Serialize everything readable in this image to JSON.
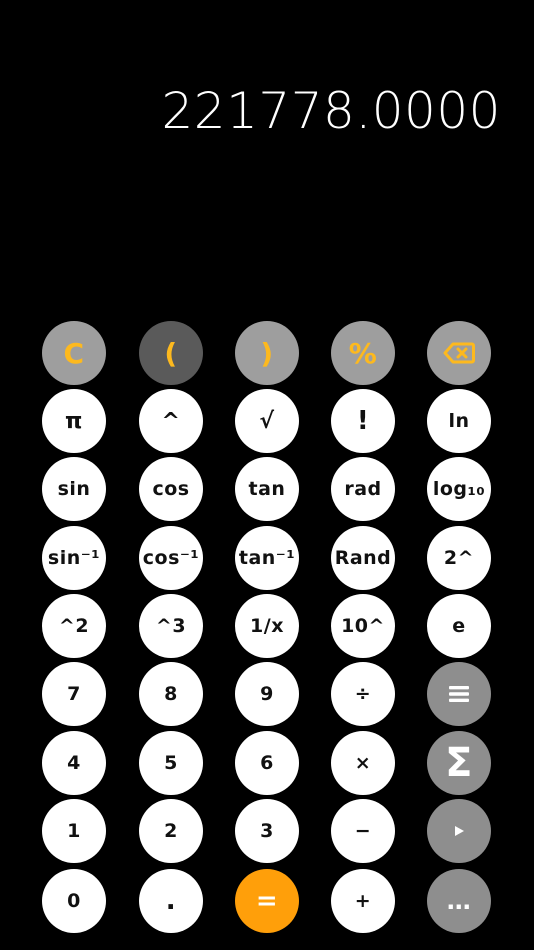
{
  "display": {
    "value": "221778.0000"
  },
  "colors": {
    "background": "#000000",
    "display_text": "#ffffff",
    "key_white": "#ffffff",
    "key_gray": "#8e8e8e",
    "key_top_gray": "#9e9e9e",
    "key_top_dark": "#5a5a5a",
    "accent_yellow": "#fdb91e",
    "equals_orange": "#ff9f0a"
  },
  "keys": {
    "clear": "C",
    "open_paren": "(",
    "close_paren": ")",
    "percent": "%",
    "backspace_icon": "backspace-icon",
    "pi": "π",
    "power": "^",
    "sqrt": "√",
    "factorial": "!",
    "ln": "ln",
    "sin": "sin",
    "cos": "cos",
    "tan": "tan",
    "rad": "rad",
    "log10": "log₁₀",
    "asin": "sin⁻¹",
    "acos": "cos⁻¹",
    "atan": "tan⁻¹",
    "rand": "Rand",
    "two_pow": "2^",
    "square": "^2",
    "cube": "^3",
    "reciprocal": "1/x",
    "ten_pow": "10^",
    "e": "e",
    "d7": "7",
    "d8": "8",
    "d9": "9",
    "divide": "÷",
    "menu_icon": "menu-icon",
    "d4": "4",
    "d5": "5",
    "d6": "6",
    "multiply": "×",
    "sigma": "Σ",
    "d1": "1",
    "d2": "2",
    "d3": "3",
    "minus": "−",
    "play_icon": "play-icon",
    "d0": "0",
    "dot": ".",
    "equals": "=",
    "plus": "+",
    "more": "…"
  }
}
